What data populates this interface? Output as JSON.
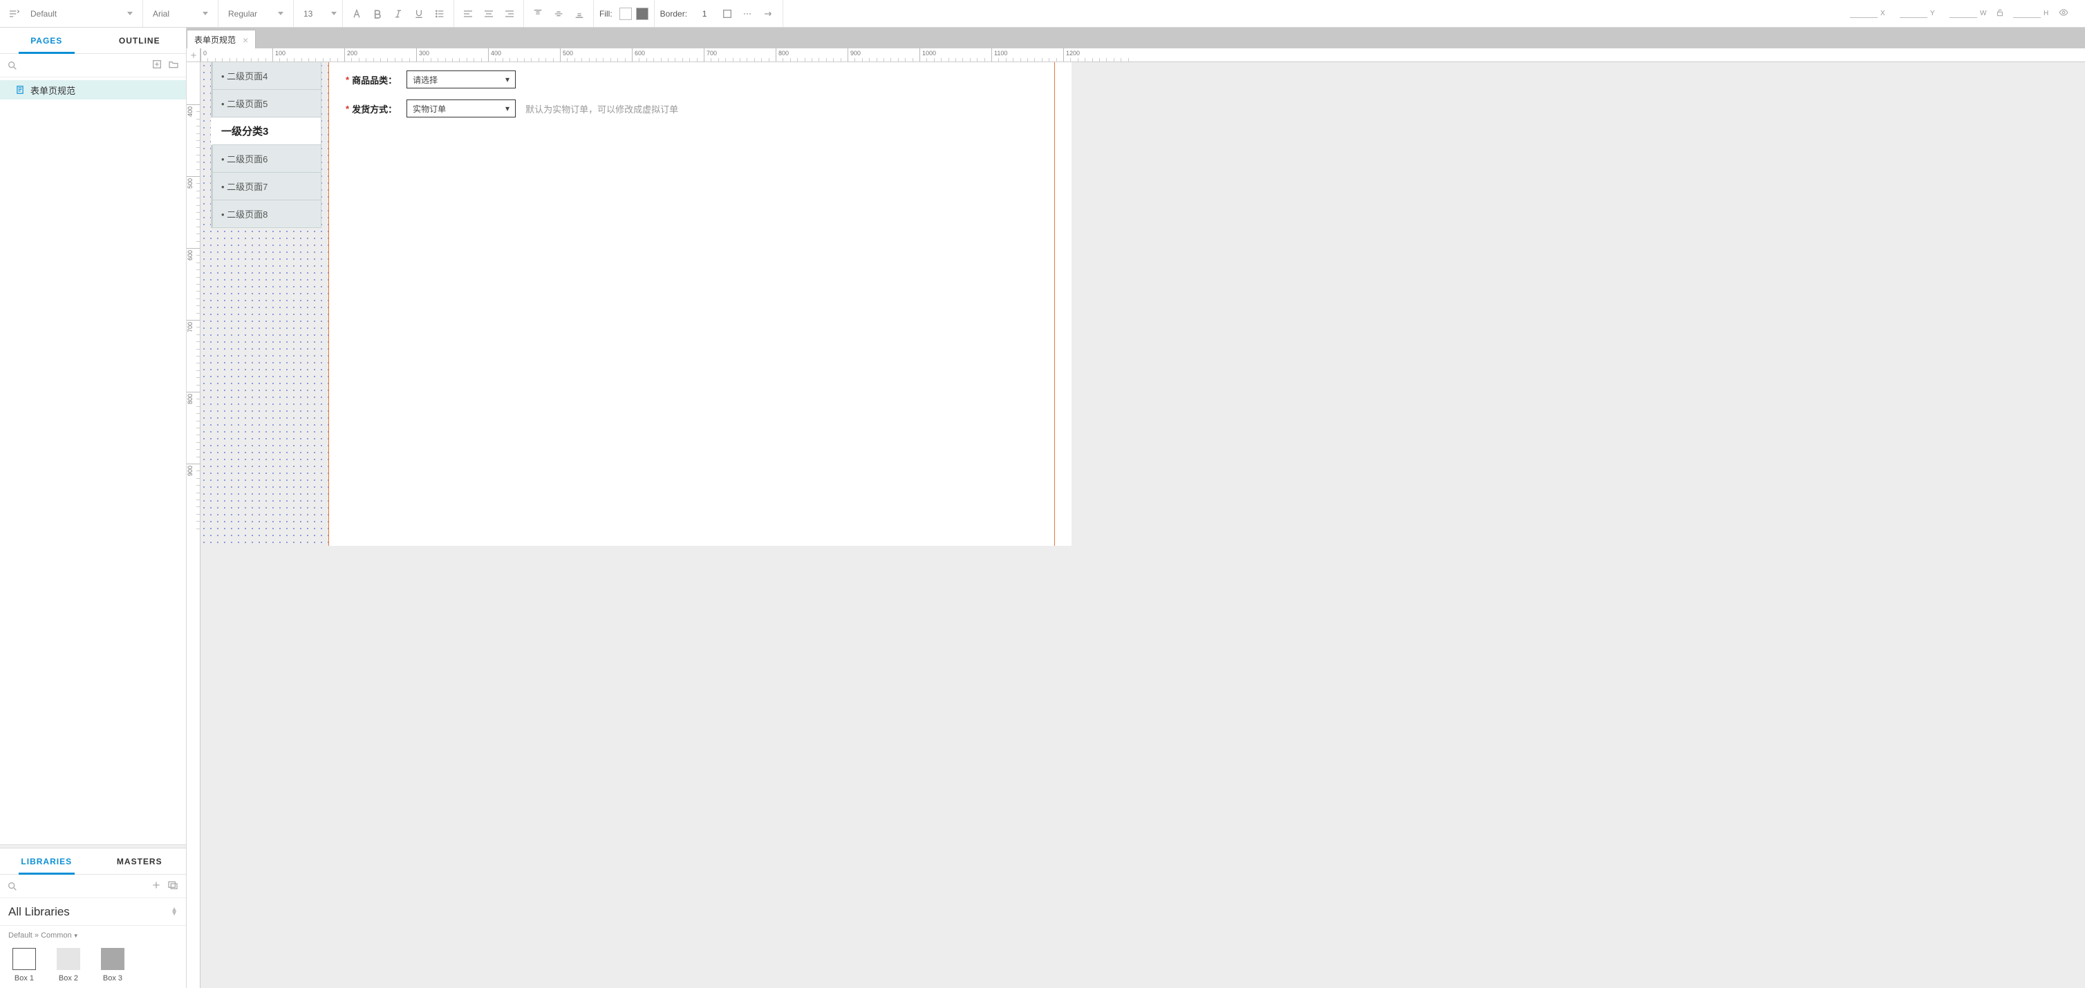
{
  "toolbar": {
    "style_dd": "Default",
    "font_dd": "Arial",
    "weight_dd": "Regular",
    "size_dd": "13",
    "fill_label": "Fill:",
    "border_label": "Border:",
    "border_width": "1",
    "pos": {
      "x": "X",
      "y": "Y",
      "w": "W",
      "h": "H"
    }
  },
  "left": {
    "tabs": {
      "pages": "PAGES",
      "outline": "OUTLINE"
    },
    "page_name": "表单页规范",
    "lib_tabs": {
      "libraries": "LIBRARIES",
      "masters": "MASTERS"
    },
    "lib_dd": "All Libraries",
    "lib_section": "Default » Common",
    "lib_items": [
      "Box 1",
      "Box 2",
      "Box 3"
    ]
  },
  "doc_tab": "表单页规范",
  "ruler_h": [
    "0",
    "100",
    "200",
    "300",
    "400",
    "500",
    "600",
    "700",
    "800",
    "900",
    "1000",
    "1100",
    "1200"
  ],
  "ruler_v": [
    "400",
    "500",
    "600",
    "700",
    "800",
    "900"
  ],
  "mock_nav": {
    "items_top": [
      "• 二级页面4",
      "• 二级页面5"
    ],
    "header": "一级分类3",
    "items_bottom": [
      "• 二级页面6",
      "• 二级页面7",
      "• 二级页面8"
    ]
  },
  "form": {
    "row1": {
      "label": "商品品类：",
      "value": "请选择"
    },
    "row2": {
      "label": "发货方式：",
      "value": "实物订单",
      "hint": "默认为实物订单，可以修改成虚拟订单"
    }
  }
}
